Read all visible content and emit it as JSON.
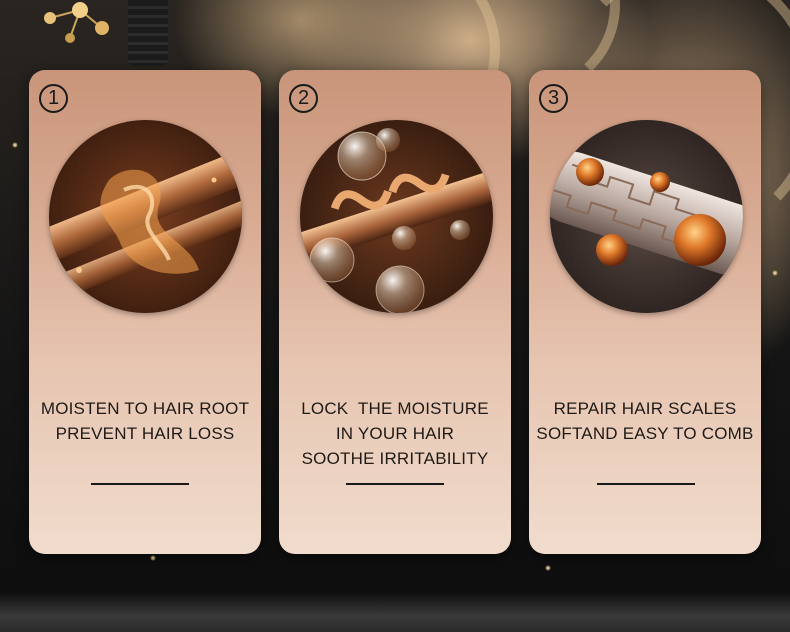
{
  "cards": [
    {
      "number": "1",
      "image_name": "hair-strand-moisture-image",
      "lines": [
        "MOISTEN TO HAIR ROOT",
        "PREVENT HAIR LOSS"
      ]
    },
    {
      "number": "2",
      "image_name": "moisture-droplets-image",
      "lines": [
        "LOCK  THE MOISTURE",
        "IN YOUR HAIR",
        "SOOTHE IRRITABILITY"
      ]
    },
    {
      "number": "3",
      "image_name": "hair-scales-repair-image",
      "lines": [
        "REPAIR HAIR SCALES",
        "SOFTAND EASY TO COMB"
      ]
    }
  ],
  "colors": {
    "card_top": "#c9957a",
    "card_bottom": "#f1dccd",
    "text": "#1f1a17",
    "background": "#141414"
  }
}
